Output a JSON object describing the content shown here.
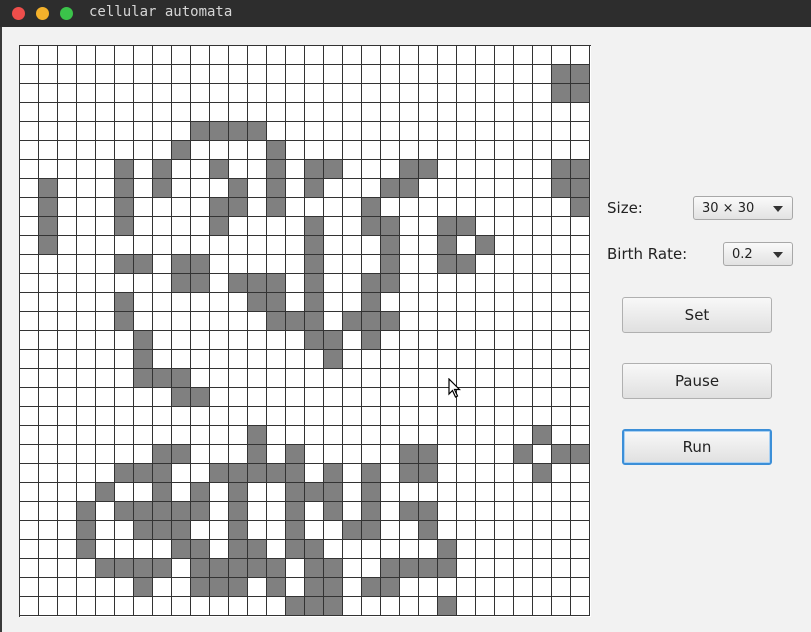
{
  "window": {
    "title": "cellular automata"
  },
  "controls": {
    "size_label": "Size:",
    "size_value": "30 × 30",
    "birth_rate_label": "Birth Rate:",
    "birth_rate_value": "0.2",
    "set_label": "Set",
    "pause_label": "Pause",
    "run_label": "Run"
  },
  "grid": {
    "rows": 30,
    "cols": 30,
    "live_color": "#808080",
    "dead_color": "#ffffff",
    "cells": [
      "000000000000000000000000000000",
      "000000000000000000000000000011",
      "000000000000000000000000000011",
      "000000000000000000000000000000",
      "000000000111100000000000000000",
      "000000001000010000000000000000",
      "000001010010010110001100000011",
      "010001010001010100011000000011",
      "010001000011010000100000000001",
      "010001000010000100110011000000",
      "010000000000000100010010100000",
      "000001101100000100010011000000",
      "000000001101110100110000000000",
      "000001000000110100100000000000",
      "000001000000011101110000000000",
      "000000100000000110100000000000",
      "000000100000000010000000000000",
      "000000111000000000000000000000",
      "000000001100000000000000000000",
      "000000000000000000000000000000",
      "000000000000100000000000000100",
      "000000011000101000001100001011",
      "000001110011111010101100000100",
      "000010010101001110100000000000",
      "000101111101001010101100000000",
      "000100111001001001100100000000",
      "000100001101101100000010000000",
      "000011110111110110011110000000",
      "000000100111010110110000000000",
      "000000000000001110000010000000"
    ]
  }
}
